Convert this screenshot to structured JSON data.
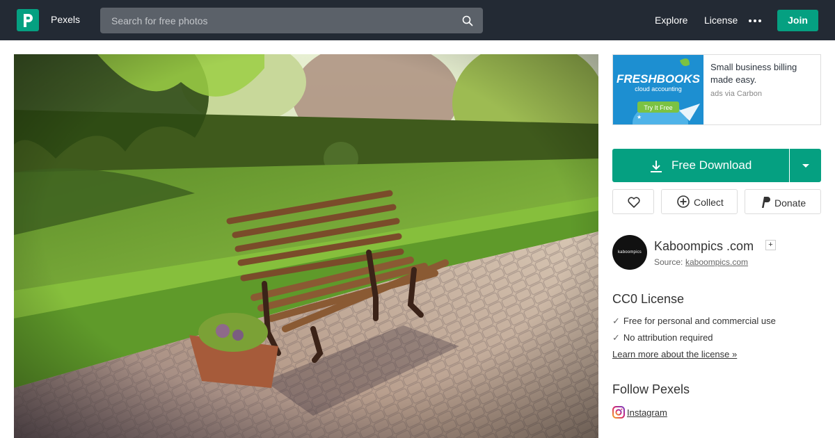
{
  "header": {
    "brand": "Pexels",
    "search_placeholder": "Search for free photos",
    "nav": [
      "Explore",
      "License"
    ],
    "join_label": "Join"
  },
  "photo": {
    "icon": "park-bench-photo"
  },
  "ad": {
    "logo_text": "FRESHBOOKS",
    "logo_sub": "cloud accounting",
    "cta": "Try It Free",
    "text": "Small business billing made easy.",
    "via": "ads via Carbon"
  },
  "actions": {
    "download_label": "Free Download",
    "collect_label": "Collect",
    "donate_label": "Donate"
  },
  "author": {
    "avatar_text": "kaboompics",
    "name": "Kaboompics .com",
    "follow_symbol": "+",
    "source_label": "Source:",
    "source_link": "kaboompics.com"
  },
  "license": {
    "title": "CC0 License",
    "check_mark": "✓",
    "points": [
      "Free for personal and commercial use",
      "No attribution required"
    ],
    "link": "Learn more about the license »"
  },
  "follow": {
    "title": "Follow Pexels",
    "instagram": "Instagram"
  },
  "colors": {
    "header_bg": "#232a34",
    "accent": "#05a081"
  }
}
